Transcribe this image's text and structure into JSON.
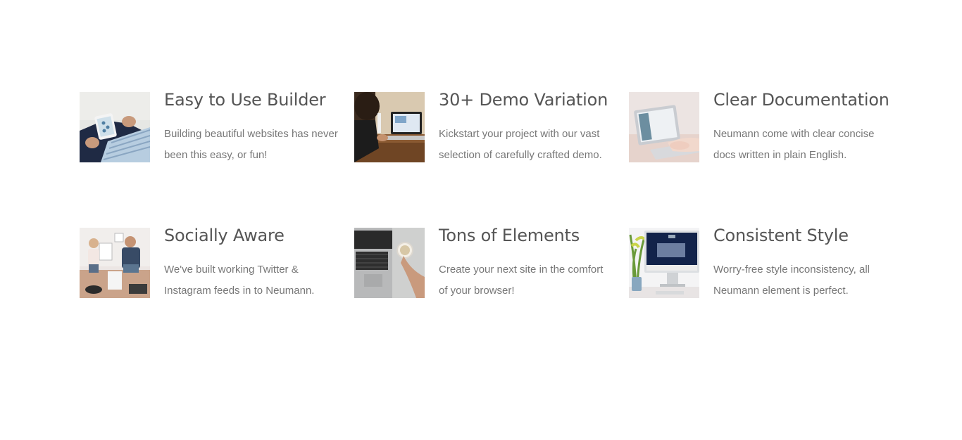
{
  "features": [
    {
      "title": "Easy to Use Builder",
      "description": "Building beautiful websites has never been this easy, or fun!",
      "image_icon": "tablet-photo"
    },
    {
      "title": "30+ Demo Variation",
      "description": "Kickstart your project with our vast selection of carefully crafted demo.",
      "image_icon": "laptop-desk-photo"
    },
    {
      "title": "Clear Documentation",
      "description": "Neumann come with clear concise docs written in plain English.",
      "image_icon": "laptop-typing-photo"
    },
    {
      "title": "Socially Aware",
      "description": "We've built working Twitter & Instagram feeds in to Neumann.",
      "image_icon": "office-people-photo"
    },
    {
      "title": "Tons of Elements",
      "description": "Create your next site in the comfort of your browser!",
      "image_icon": "laptop-coffee-photo"
    },
    {
      "title": "Consistent Style",
      "description": "Worry-free style inconsistency, all Neumann element is perfect.",
      "image_icon": "imac-plant-photo"
    }
  ],
  "colors": {
    "title": "#555555",
    "text": "#777777",
    "background": "#ffffff"
  }
}
